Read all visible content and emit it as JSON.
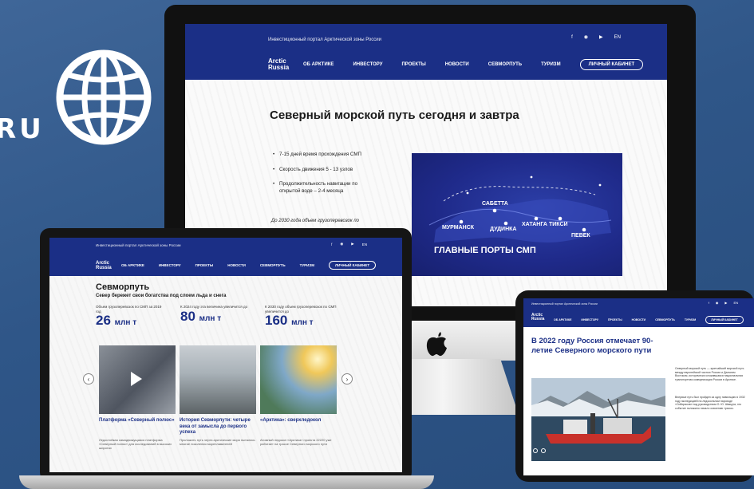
{
  "brand": {
    "domain_fragment": "RU",
    "logo_line1": "Arctic",
    "logo_line2": "Russia",
    "tagline": "Инвестиционный портал Арктической зоны России",
    "lang": "EN",
    "cabinet": "ЛИЧНЫЙ КАБИНЕТ"
  },
  "nav": [
    "ОБ АРКТИКЕ",
    "ИНВЕСТОРУ",
    "ПРОЕКТЫ",
    "НОВОСТИ",
    "СЕВМОРПУТЬ",
    "ТУРИЗМ"
  ],
  "desktop": {
    "title": "Северный морской путь сегодня и завтра",
    "bullets": [
      "7-15 дней время прохождения СМП",
      "Скорость движения 5 - 13 узлов",
      "Продолжительность навигации по открытой воде – 2-4 месяца"
    ],
    "note": "До 2030 года объем грузоперевозок по",
    "map": {
      "caption": "ГЛАВНЫЕ ПОРТЫ СМП",
      "ports": [
        "САБЕТТА",
        "МУРМАНСК",
        "ДУДИНКА",
        "ХАТАНГА",
        "ТИКСИ",
        "ПЕВЕК"
      ]
    }
  },
  "laptop": {
    "title": "Севморпуть",
    "subtitle": "Север бережет свои богатства под слоем льда и снега",
    "stats": [
      {
        "label": "Объем грузоперевозок по СМП за 2019 год",
        "value": "26",
        "unit": "млн т"
      },
      {
        "label": "К 2024 году эта величина увеличится до",
        "value": "80",
        "unit": "млн т"
      },
      {
        "label": "К 2030 году объем грузоперевозок по СМП увеличится до",
        "value": "160",
        "unit": "млн т"
      }
    ],
    "cards": [
      {
        "title": "Платформа «Северный полюс»",
        "text": "Ледостойкая самодвижущаяся платформа «Северный полюс» для исследований в высоких широтах"
      },
      {
        "title": "История Севморпути: четыре века от замысла до первого успеха",
        "text": "Проложить путь через арктические моря пытались многие поколения мореплавателей"
      },
      {
        "title": "«Арктика»: сверхледокол",
        "text": "Атомный ледокол «Арктика» проекта 22220 уже работает на трассе Северного морского пути"
      }
    ]
  },
  "tablet": {
    "title": "В 2022 году Россия отмечает 90-летие Северного морского пути",
    "paragraph1": "Северный морской путь — кратчайший морской путь между европейской частью России и Дальним Востоком, исторически сложившаяся национальная транспортная коммуникация России в Арктике.",
    "paragraph2": "Впервые путь был пройден за одну навигацию в 1932 году экспедицией на ледокольном пароходе «Сибиряков» под руководством О. Ю. Шмидта; это событие положило начало освоению трассы."
  },
  "colors": {
    "brand_blue": "#1b2f86",
    "background": "#2f5688"
  }
}
